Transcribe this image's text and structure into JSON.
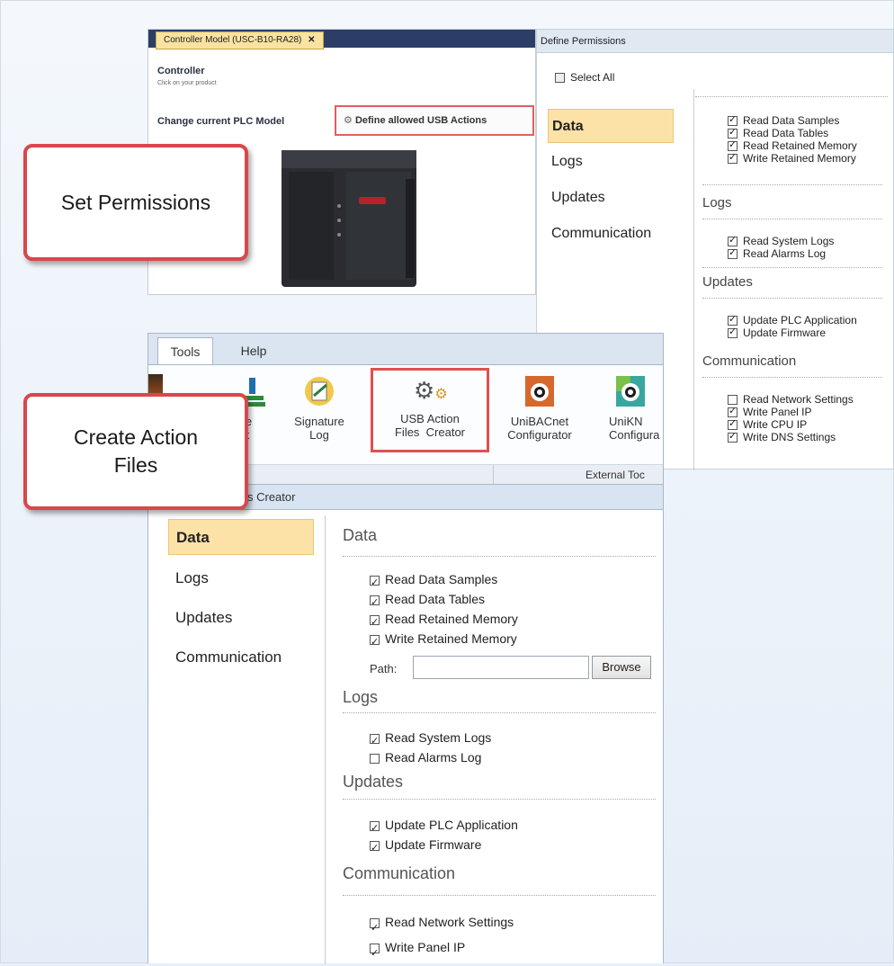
{
  "controller_panel": {
    "tab_label": "Controller Model (USC-B10-RA28)",
    "tab_close": "✕",
    "title": "Controller",
    "subtitle": "Click on your product",
    "change_model_label": "Change current PLC Model",
    "define_usb_button": "Define allowed USB Actions"
  },
  "define_permissions": {
    "header": "Define Permissions",
    "select_all": "Select All",
    "nav": [
      "Data",
      "Logs",
      "Updates",
      "Communication"
    ],
    "sections": {
      "logs": "Logs",
      "updates": "Updates",
      "communication": "Communication"
    },
    "data_items": [
      {
        "label": "Read Data Samples",
        "checked": true
      },
      {
        "label": "Read Data Tables",
        "checked": true
      },
      {
        "label": "Read Retained Memory",
        "checked": true
      },
      {
        "label": "Write Retained Memory",
        "checked": true
      }
    ],
    "logs_items": [
      {
        "label": "Read System Logs",
        "checked": true
      },
      {
        "label": "Read Alarms Log",
        "checked": true
      }
    ],
    "updates_items": [
      {
        "label": "Update PLC Application",
        "checked": true
      },
      {
        "label": "Update Firmware",
        "checked": true
      }
    ],
    "comm_items": [
      {
        "label": "Read Network Settings",
        "checked": false
      },
      {
        "label": "Write Panel IP",
        "checked": true
      },
      {
        "label": "Write CPU IP",
        "checked": true
      },
      {
        "label": "Write DNS Settings",
        "checked": true
      }
    ]
  },
  "ribbon": {
    "tabs": [
      "Tools",
      "Help"
    ],
    "buttons": {
      "analyze": "lyze\nject",
      "signature": "Signature\nLog",
      "usb_action": "USB Action\nFiles  Creator",
      "unibacnet": "UniBACnet\nConfigurator",
      "uniknx": "UniKN\nConfigura"
    },
    "group_label": "External Toc"
  },
  "creator": {
    "header": "s  Creator",
    "nav": [
      "Data",
      "Logs",
      "Updates",
      "Communication"
    ],
    "sections": {
      "data": "Data",
      "logs": "Logs",
      "updates": "Updates",
      "communication": "Communication"
    },
    "data_items": [
      {
        "label": "Read Data Samples",
        "checked": true
      },
      {
        "label": "Read Data Tables",
        "checked": true
      },
      {
        "label": "Read Retained Memory",
        "checked": true
      },
      {
        "label": "Write Retained Memory",
        "checked": true
      }
    ],
    "path_label": "Path:",
    "path_value": "",
    "browse": "Browse",
    "logs_items": [
      {
        "label": "Read System Logs",
        "checked": true
      },
      {
        "label": "Read Alarms Log",
        "checked": false
      }
    ],
    "updates_items": [
      {
        "label": "Update PLC Application",
        "checked": true
      },
      {
        "label": "Update Firmware",
        "checked": true
      }
    ],
    "comm_items": [
      {
        "label": "Read Network Settings",
        "checked": true
      },
      {
        "label": "Write Panel IP",
        "checked": true
      }
    ]
  },
  "callouts": {
    "set_permissions": "Set Permissions",
    "create_action_files": "Create Action\nFiles"
  },
  "colors": {
    "callout_border": "#d8474b",
    "active_nav": "#fde2a8",
    "tab_bar": "#2b3f66"
  }
}
